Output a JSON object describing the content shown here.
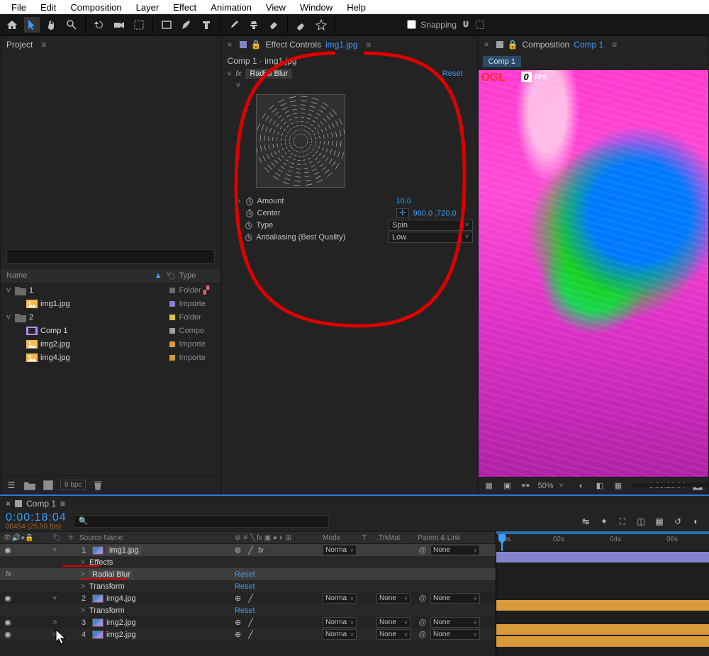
{
  "menubar": [
    "File",
    "Edit",
    "Composition",
    "Layer",
    "Effect",
    "Animation",
    "View",
    "Window",
    "Help"
  ],
  "snapping_label": "Snapping",
  "project": {
    "tab": "Project",
    "search_placeholder": "",
    "cols": {
      "name": "Name",
      "type": "Type"
    },
    "rows": [
      {
        "indent": 0,
        "tw": "˅",
        "icon": "folder",
        "name": "1",
        "label": "#6c6c6c",
        "type": "Folder",
        "net": true
      },
      {
        "indent": 1,
        "tw": "",
        "icon": "image",
        "name": "img1.jpg",
        "label": "#8484cc",
        "type": "Importe"
      },
      {
        "indent": 0,
        "tw": "˅",
        "icon": "folder",
        "name": "2",
        "label": "#d8c24a",
        "type": "Folder"
      },
      {
        "indent": 1,
        "tw": "",
        "icon": "comp",
        "name": "Comp 1",
        "label": "#a0a0a0",
        "type": "Compo"
      },
      {
        "indent": 1,
        "tw": "",
        "icon": "image",
        "name": "img2.jpg",
        "label": "#d89a3a",
        "type": "Importe"
      },
      {
        "indent": 1,
        "tw": "",
        "icon": "image",
        "name": "img4.jpg",
        "label": "#d89a3a",
        "type": "Importe"
      }
    ],
    "bpc": "8 bpc"
  },
  "fx": {
    "tab_prefix": "Effect Controls ",
    "tab_file": "img1.jpg",
    "breadcrumb": "Comp 1 · img1.jpg",
    "effect_name": "Radial Blur",
    "reset": "Reset",
    "props": {
      "amount": {
        "name": "Amount",
        "value": "10,0"
      },
      "center": {
        "name": "Center",
        "value": "960,0 ,720,0"
      },
      "type": {
        "name": "Type",
        "value": "Spin"
      },
      "aa": {
        "name": "Antialiasing (Best Quality)",
        "value": "Low"
      }
    }
  },
  "comp": {
    "tab_prefix": "Composition ",
    "tab_name": "Comp 1",
    "chip": "Comp 1",
    "ogl": "OGL",
    "fps_n": "0",
    "fps_t": "FPS",
    "zoom": "50%",
    "time": "0:00:18:04"
  },
  "timeline": {
    "tab": "Comp 1",
    "timecode": "0:00:18:04",
    "timecode_sub": "00454 (25.00 fps)",
    "header": {
      "idx": "#",
      "src": "Source Name",
      "mode": "Mode",
      "t": "T",
      "trk": ".TrkMat",
      "par": "Parent & Link"
    },
    "ruler": [
      "00s",
      "02s",
      "04s",
      "06s"
    ],
    "layers": [
      {
        "idx": "1",
        "name": "img1.jpg",
        "label": "#8484cc",
        "mode": "Norma",
        "trk": "",
        "par": "None",
        "sel": true
      },
      {
        "sub": true,
        "name": "Effects",
        "tw": "˅"
      },
      {
        "sub": true,
        "name": "Radial Blur",
        "tw": ">",
        "reset": "Reset",
        "fx": true,
        "sel": true
      },
      {
        "sub": true,
        "name": "Transform",
        "tw": ">",
        "reset": "Reset"
      },
      {
        "idx": "2",
        "name": "img4.jpg",
        "label": "#8484cc",
        "mode": "Norma",
        "trk": "None",
        "par": "None"
      },
      {
        "sub": true,
        "name": "Transform",
        "tw": ">",
        "reset": "Reset"
      },
      {
        "idx": "3",
        "name": "img2.jpg",
        "label": "#d89a3a",
        "mode": "Norma",
        "trk": "None",
        "par": "None"
      },
      {
        "idx": "4",
        "name": "img2.jpg",
        "label": "#d89a3a",
        "mode": "Norma",
        "trk": "None",
        "par": "None"
      }
    ]
  }
}
